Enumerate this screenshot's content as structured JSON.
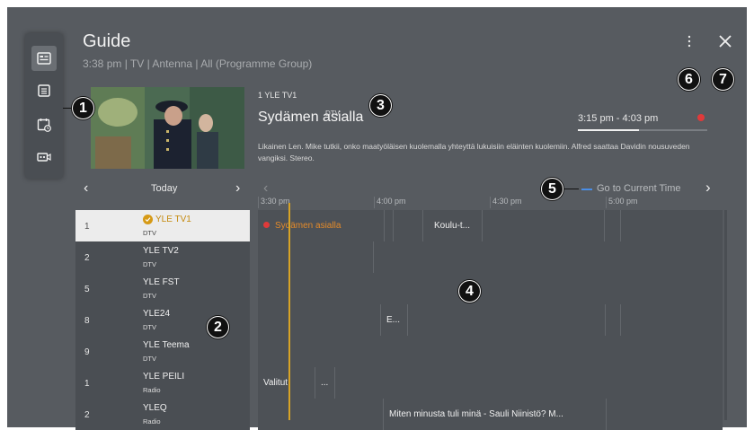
{
  "header": {
    "title": "Guide",
    "subtitle": "3:38 pm | TV | Antenna | All (Programme Group)"
  },
  "icons": {
    "sidebar": [
      "guide-icon",
      "list-icon",
      "schedule-icon",
      "recordings-icon"
    ],
    "menu": "more-vertical-icon",
    "close": "close-icon"
  },
  "callouts": [
    "1",
    "2",
    "3",
    "4",
    "5",
    "6",
    "7"
  ],
  "program": {
    "channel_type": "DTV",
    "channel_number": "1",
    "channel_name": "YLE TV1",
    "title": "Sydämen asialla",
    "time": "3:15 pm - 4:03 pm",
    "progress": 0.47,
    "description": "Likainen Len. Mike tutkii, onko maatyöläisen kuolemalla yhteyttä lukuisiin eläinten kuolemiin. Alfred saattaa Davidin nousuveden vangiksi. Stereo."
  },
  "navigation": {
    "prev_day": "‹",
    "day": "Today",
    "next_day": "›",
    "prev_time": "‹",
    "go_current": "Go to Current Time",
    "next_time": "›"
  },
  "timeline": [
    "3:30 pm",
    "4:00 pm",
    "4:30 pm",
    "5:00 pm"
  ],
  "channels": [
    {
      "number": "1",
      "name": "YLE TV1",
      "type": "DTV",
      "selected": true
    },
    {
      "number": "2",
      "name": "YLE TV2",
      "type": "DTV"
    },
    {
      "number": "5",
      "name": "YLE FST",
      "type": "DTV"
    },
    {
      "number": "8",
      "name": "YLE24",
      "type": "DTV"
    },
    {
      "number": "9",
      "name": "YLE Teema",
      "type": "DTV"
    },
    {
      "number": "1",
      "name": "YLE PEILI",
      "type": "Radio"
    },
    {
      "number": "2",
      "name": "YLEQ",
      "type": "Radio"
    }
  ],
  "programs": {
    "row1": [
      "Sydämen asialla",
      "",
      "",
      "Koulu-t...",
      "",
      ""
    ],
    "row4": [
      "",
      "E...",
      "",
      ""
    ],
    "row6": [
      "Valitut",
      "..."
    ],
    "row7": [
      "",
      "Miten minusta tuli minä - Sauli Niinistö? M..."
    ]
  },
  "colors": {
    "background": "#575b60",
    "accent": "#d69a16",
    "record": "#e03a3a",
    "highlight_link": "#4a8ee6"
  }
}
